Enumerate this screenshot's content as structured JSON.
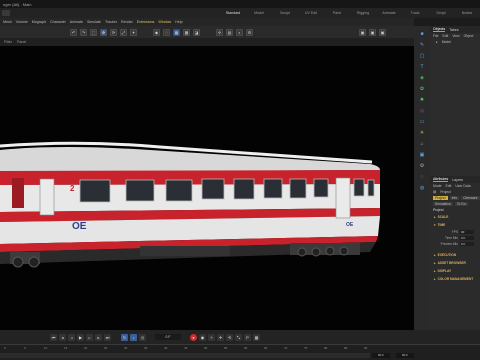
{
  "window": {
    "title": "nger (All) - Main"
  },
  "layouts": [
    "Standard",
    "Model",
    "Sculpt",
    "UV Edit",
    "Paint",
    "Rigging",
    "Animate",
    "Track",
    "Script",
    "Nodes"
  ],
  "menu": [
    "Mesh",
    "Volume",
    "Mograph",
    "Character",
    "Animate",
    "Simulate",
    "Tracker",
    "Render",
    "Extensions",
    "Window",
    "Help"
  ],
  "viewport_menu": [
    "Filter",
    "Panel"
  ],
  "object_panel": {
    "tabs": [
      "Objects",
      "Takes"
    ],
    "menu": [
      "File",
      "Edit",
      "View",
      "Object",
      "Tags"
    ],
    "objects": [
      "Model"
    ]
  },
  "attributes_panel": {
    "tabs": [
      "Attributes",
      "Layers"
    ],
    "menu": [
      "Mode",
      "Edit",
      "User Data"
    ],
    "title": "Project",
    "subtabs": [
      "Project",
      "Info",
      "Cineware"
    ],
    "subtabs2": [
      "Simulation",
      "To Do"
    ],
    "section_header": "Project",
    "scale_label": "SCALE",
    "time_label": "TIME",
    "fields": [
      {
        "label": "FPS",
        "value": "30"
      },
      {
        "label": "Time Min",
        "value": "0 F"
      },
      {
        "label": "Preview Min",
        "value": "0 F"
      }
    ],
    "collapsed": [
      "EXECUTION",
      "ASSET BROWSER",
      "DISPLAY",
      "COLOR MANAGEMENT"
    ]
  },
  "train": {
    "logo": "OE",
    "number": "2"
  },
  "timeline": {
    "current_frame": "0 F",
    "end_frame": "90 F",
    "end_right": "90 F"
  },
  "ruler_ticks": [
    "0",
    "5",
    "10",
    "15",
    "20",
    "25",
    "30",
    "35",
    "40",
    "45",
    "50",
    "55",
    "60",
    "65",
    "70",
    "75",
    "80",
    "85",
    "90"
  ],
  "colors": {
    "accent_section": "#e0b05c",
    "train_red": "#c8232c",
    "train_body": "#e8e8e8",
    "menu_highlight": "#e0c36a"
  }
}
